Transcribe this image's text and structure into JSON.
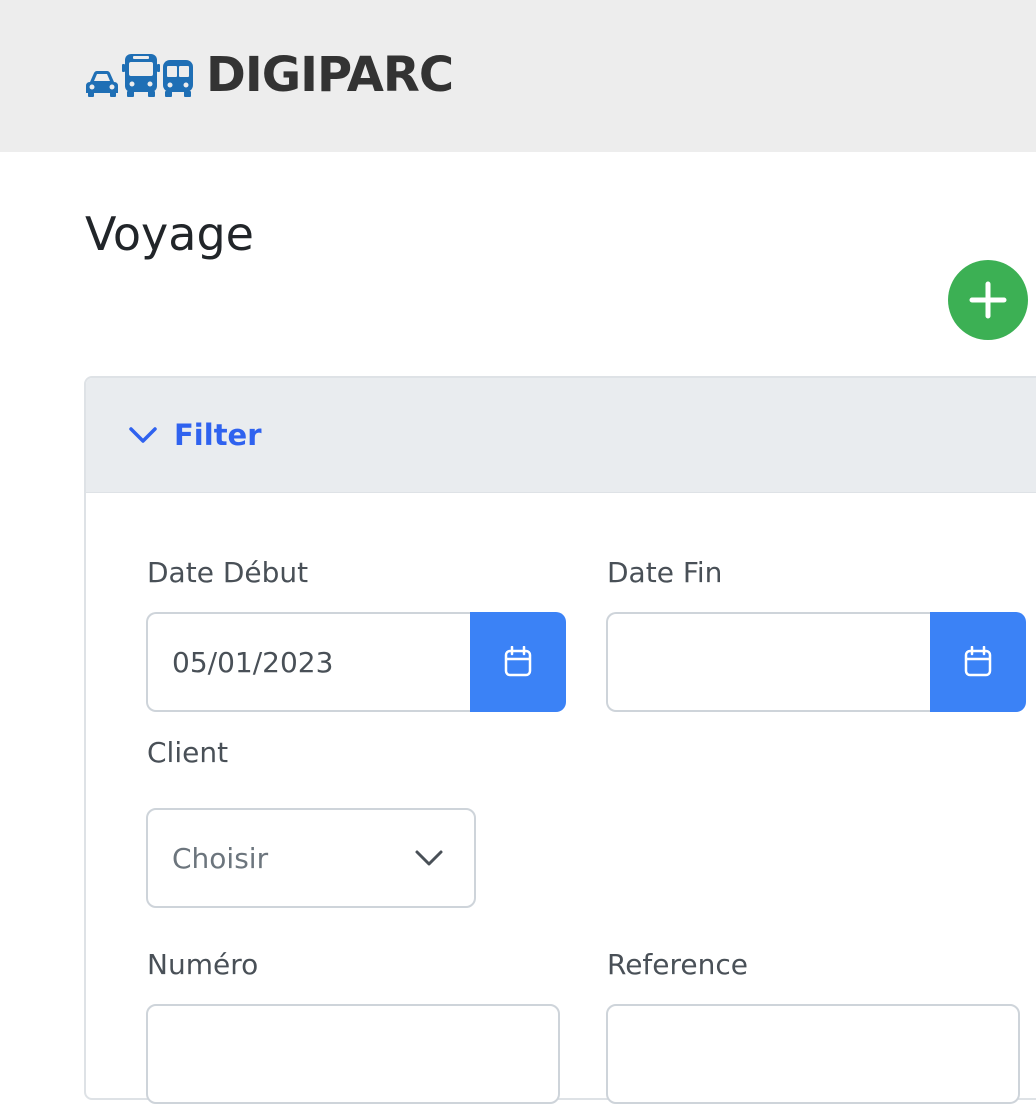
{
  "header": {
    "brand": "DIGIPARC",
    "icons": [
      "car-icon",
      "bus-icon",
      "train-icon"
    ],
    "background": "#ededed",
    "brand_color": "#333333",
    "icon_color": "#1f6fb5"
  },
  "page": {
    "title": "Voyage",
    "add_button_icon": "plus-icon",
    "add_button_color": "#3cb054"
  },
  "filter": {
    "title": "Filter",
    "toggle_icon": "chevron-down-icon",
    "accent": "#2f62ef",
    "date_debut": {
      "label": "Date Début",
      "value": "05/01/2023",
      "button_icon": "calendar-icon"
    },
    "date_fin": {
      "label": "Date Fin",
      "value": "",
      "button_icon": "calendar-icon"
    },
    "client": {
      "label": "Client",
      "selected": "Choisir",
      "icon": "chevron-down-icon"
    },
    "numero": {
      "label": "Numéro",
      "value": ""
    },
    "reference": {
      "label": "Reference",
      "value": ""
    },
    "button_color": "#3b82f6"
  }
}
